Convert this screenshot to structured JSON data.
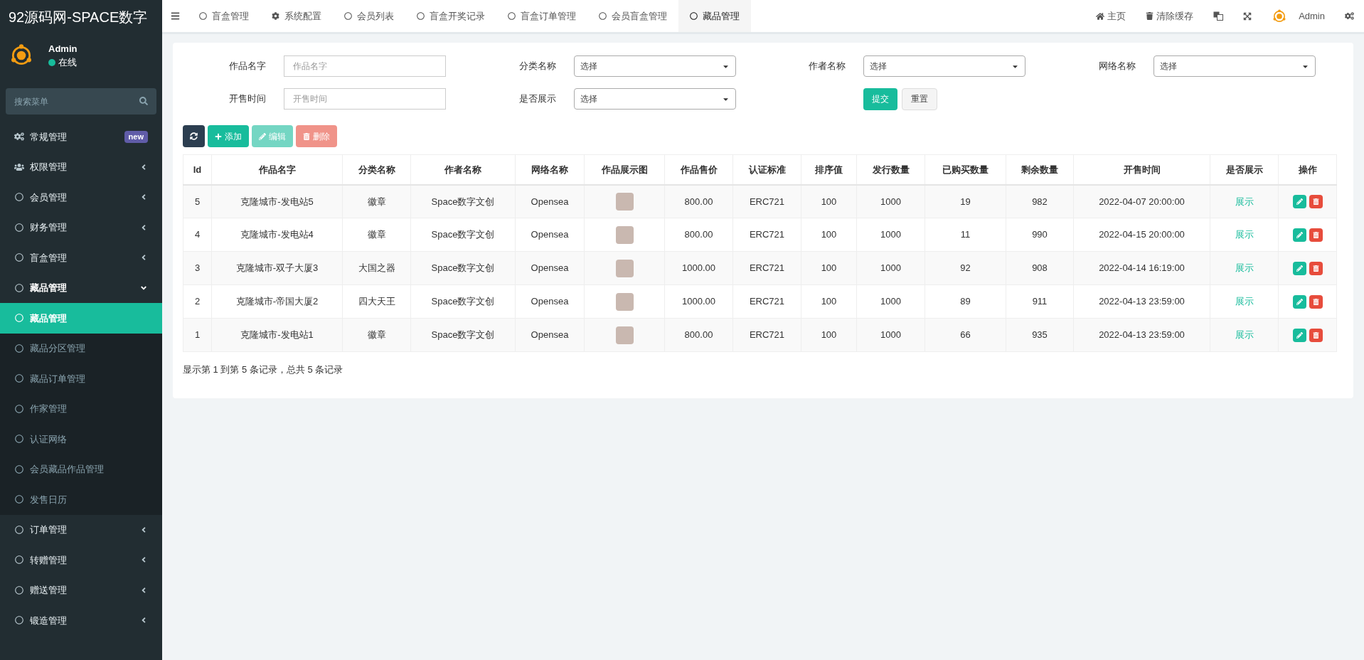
{
  "brand": "92源码网-SPACE数字",
  "user": {
    "name": "Admin",
    "status": "在线"
  },
  "menu_search": {
    "placeholder": "搜索菜单"
  },
  "sidebar": {
    "items": [
      {
        "label": "常规管理",
        "kind": "gears",
        "badge": "new",
        "selected": false
      },
      {
        "label": "权限管理",
        "kind": "users",
        "expanded": false,
        "selected": false
      },
      {
        "label": "会员管理",
        "kind": "circle",
        "expanded": false,
        "selected": false
      },
      {
        "label": "财务管理",
        "kind": "circle",
        "expanded": false,
        "selected": false
      },
      {
        "label": "盲盒管理",
        "kind": "circle",
        "expanded": false,
        "selected": false
      },
      {
        "label": "藏品管理",
        "kind": "circle",
        "expanded": true,
        "selected": false,
        "children": [
          {
            "label": "藏品管理",
            "selected": true
          },
          {
            "label": "藏品分区管理",
            "selected": false
          },
          {
            "label": "藏品订单管理",
            "selected": false
          },
          {
            "label": "作家管理",
            "selected": false
          },
          {
            "label": "认证网络",
            "selected": false
          },
          {
            "label": "会员藏品作品管理",
            "selected": false
          },
          {
            "label": "发售日历",
            "selected": false
          }
        ]
      },
      {
        "label": "订单管理",
        "kind": "circle",
        "expanded": false,
        "selected": false
      },
      {
        "label": "转赠管理",
        "kind": "circle",
        "expanded": false,
        "selected": false
      },
      {
        "label": "赠送管理",
        "kind": "circle",
        "expanded": false,
        "selected": false
      },
      {
        "label": "锻造管理",
        "kind": "circle",
        "expanded": false,
        "selected": false
      }
    ]
  },
  "tabs": [
    {
      "label": "盲盒管理",
      "kind": "circle",
      "selected": false
    },
    {
      "label": "系统配置",
      "kind": "gear",
      "selected": false
    },
    {
      "label": "会员列表",
      "kind": "circle",
      "selected": false
    },
    {
      "label": "盲盒开奖记录",
      "kind": "circle",
      "selected": false
    },
    {
      "label": "盲盒订单管理",
      "kind": "circle",
      "selected": false
    },
    {
      "label": "会员盲盒管理",
      "kind": "circle",
      "selected": false
    },
    {
      "label": "藏品管理",
      "kind": "circle",
      "selected": true
    }
  ],
  "top_actions": [
    {
      "label": "主页",
      "kind": "home"
    },
    {
      "label": "清除缓存",
      "kind": "trash"
    }
  ],
  "top_user": "Admin",
  "filters": [
    {
      "label": "作品名字",
      "kind": "input",
      "placeholder": "作品名字"
    },
    {
      "label": "分类名称",
      "kind": "select",
      "value": "选择"
    },
    {
      "label": "作者名称",
      "kind": "select",
      "value": "选择"
    },
    {
      "label": "网络名称",
      "kind": "select",
      "value": "选择"
    },
    {
      "label": "开售时间",
      "kind": "input",
      "placeholder": "开售时间"
    },
    {
      "label": "是否展示",
      "kind": "select",
      "value": "选择"
    }
  ],
  "filter_buttons": [
    {
      "label": "提交",
      "kind": "primary"
    },
    {
      "label": "重置",
      "kind": "default"
    }
  ],
  "toolbar": [
    {
      "kind": "refresh",
      "disabled": false
    },
    {
      "kind": "add",
      "label": "添加",
      "disabled": false
    },
    {
      "kind": "edit",
      "label": "编辑",
      "disabled": true
    },
    {
      "kind": "delete",
      "label": "删除",
      "disabled": true
    }
  ],
  "table": {
    "columns": [
      "Id",
      "作品名字",
      "分类名称",
      "作者名称",
      "网络名称",
      "作品展示图",
      "作品售价",
      "认证标准",
      "排序值",
      "发行数量",
      "已购买数量",
      "剩余数量",
      "开售时间",
      "是否展示",
      "操作"
    ],
    "rows": [
      [
        "5",
        "克隆城市-发电站5",
        "徽章",
        "Space数字文创",
        "Opensea",
        "",
        "800.00",
        "ERC721",
        "100",
        "1000",
        "19",
        "982",
        "2022-04-07 20:00:00",
        "展示",
        ""
      ],
      [
        "4",
        "克隆城市-发电站4",
        "徽章",
        "Space数字文创",
        "Opensea",
        "",
        "800.00",
        "ERC721",
        "100",
        "1000",
        "11",
        "990",
        "2022-04-15 20:00:00",
        "展示",
        ""
      ],
      [
        "3",
        "克隆城市-双子大厦3",
        "大国之器",
        "Space数字文创",
        "Opensea",
        "",
        "1000.00",
        "ERC721",
        "100",
        "1000",
        "92",
        "908",
        "2022-04-14 16:19:00",
        "展示",
        ""
      ],
      [
        "2",
        "克隆城市-帝国大厦2",
        "四大天王",
        "Space数字文创",
        "Opensea",
        "",
        "1000.00",
        "ERC721",
        "100",
        "1000",
        "89",
        "911",
        "2022-04-13 23:59:00",
        "展示",
        ""
      ],
      [
        "1",
        "克隆城市-发电站1",
        "徽章",
        "Space数字文创",
        "Opensea",
        "",
        "800.00",
        "ERC721",
        "100",
        "1000",
        "66",
        "935",
        "2022-04-13 23:59:00",
        "展示",
        ""
      ]
    ]
  },
  "pagination_info": "显示第 1 到第 5 条记录，总共 5 条记录"
}
